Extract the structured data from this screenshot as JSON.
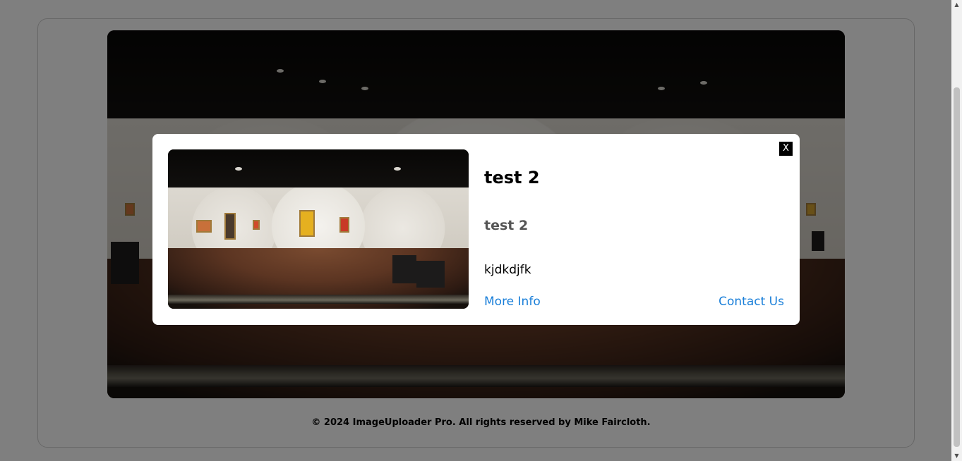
{
  "footer": {
    "text": "© 2024 ImageUploader Pro. All rights reserved by Mike Faircloth."
  },
  "modal": {
    "title": "test 2",
    "subtitle": "test 2",
    "description": "kjdkdjfk",
    "close_label": "X",
    "more_info_label": "More Info",
    "contact_label": "Contact Us"
  },
  "colors": {
    "link": "#1a7fd9",
    "overlay": "rgba(0,0,0,0.5)",
    "close_button_bg": "#000000"
  }
}
